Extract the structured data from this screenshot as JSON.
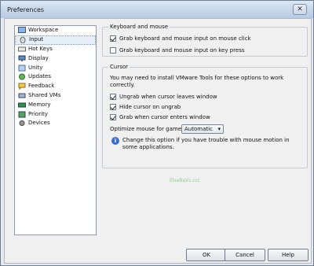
{
  "window": {
    "title": "Preferences",
    "close_glyph": "✕"
  },
  "sidebar": {
    "items": [
      {
        "label": "Workspace",
        "icon": "workspace-icon",
        "selected": false
      },
      {
        "label": "Input",
        "icon": "input-icon",
        "selected": true
      },
      {
        "label": "Hot Keys",
        "icon": "hotkeys-icon",
        "selected": false
      },
      {
        "label": "Display",
        "icon": "display-icon",
        "selected": false
      },
      {
        "label": "Unity",
        "icon": "unity-icon",
        "selected": false
      },
      {
        "label": "Updates",
        "icon": "updates-icon",
        "selected": false
      },
      {
        "label": "Feedback",
        "icon": "feedback-icon",
        "selected": false
      },
      {
        "label": "Shared VMs",
        "icon": "shared-vms-icon",
        "selected": false
      },
      {
        "label": "Memory",
        "icon": "memory-icon",
        "selected": false
      },
      {
        "label": "Priority",
        "icon": "priority-icon",
        "selected": false
      },
      {
        "label": "Devices",
        "icon": "devices-icon",
        "selected": false
      }
    ]
  },
  "keyboard_mouse": {
    "title": "Keyboard and mouse",
    "grab_on_click": {
      "label": "Grab keyboard and mouse input on mouse click",
      "checked": true
    },
    "grab_on_key": {
      "label": "Grab keyboard and mouse input on key press",
      "checked": false
    }
  },
  "cursor": {
    "title": "Cursor",
    "note": "You may need to install VMware Tools for these options to work correctly.",
    "ungrab_leave": {
      "label": "Ungrab when cursor leaves window",
      "checked": true
    },
    "hide_ungrab": {
      "label": "Hide cursor on ungrab",
      "checked": true
    },
    "grab_enter": {
      "label": "Grab when cursor enters window",
      "checked": true
    },
    "optimize_label": "Optimize mouse for games:",
    "optimize_value": "Automatic",
    "info_text": "Change this option if you have trouble with mouse motion in some applications."
  },
  "buttons": {
    "ok": "OK",
    "cancel": "Cancel",
    "help": "Help"
  },
  "watermark": "ElsaBaVs.ccc",
  "colors": {
    "title_bar": "#c5d6ea",
    "selection": "#e6eef8",
    "info": "#3d6fc6"
  }
}
